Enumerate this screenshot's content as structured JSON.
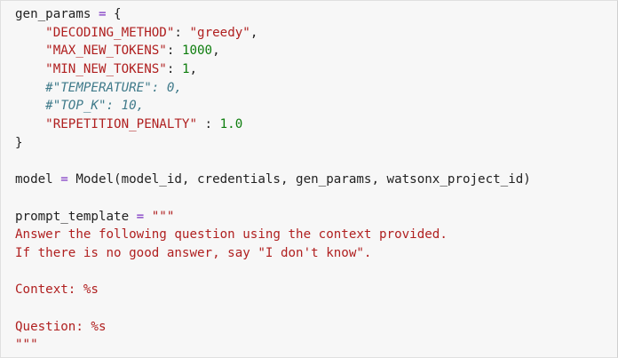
{
  "cell": {
    "lines": [
      {
        "id": "gp-open",
        "tokens": [
          {
            "t": "txt",
            "v": "gen_params "
          },
          {
            "t": "op",
            "v": "="
          },
          {
            "t": "txt",
            "v": " {"
          }
        ]
      },
      {
        "id": "gp-decode",
        "tokens": [
          {
            "t": "txt",
            "v": "    "
          },
          {
            "t": "str",
            "v": "\"DECODING_METHOD\""
          },
          {
            "t": "txt",
            "v": ": "
          },
          {
            "t": "str",
            "v": "\"greedy\""
          },
          {
            "t": "txt",
            "v": ","
          }
        ]
      },
      {
        "id": "gp-max",
        "tokens": [
          {
            "t": "txt",
            "v": "    "
          },
          {
            "t": "str",
            "v": "\"MAX_NEW_TOKENS\""
          },
          {
            "t": "txt",
            "v": ": "
          },
          {
            "t": "num",
            "v": "1000"
          },
          {
            "t": "txt",
            "v": ","
          }
        ]
      },
      {
        "id": "gp-min",
        "tokens": [
          {
            "t": "txt",
            "v": "    "
          },
          {
            "t": "str",
            "v": "\"MIN_NEW_TOKENS\""
          },
          {
            "t": "txt",
            "v": ": "
          },
          {
            "t": "num",
            "v": "1"
          },
          {
            "t": "txt",
            "v": ","
          }
        ]
      },
      {
        "id": "gp-temp",
        "tokens": [
          {
            "t": "txt",
            "v": "    "
          },
          {
            "t": "cmt",
            "v": "#\"TEMPERATURE\": 0,"
          }
        ]
      },
      {
        "id": "gp-topk",
        "tokens": [
          {
            "t": "txt",
            "v": "    "
          },
          {
            "t": "cmt",
            "v": "#\"TOP_K\": 10,"
          }
        ]
      },
      {
        "id": "gp-rep",
        "tokens": [
          {
            "t": "txt",
            "v": "    "
          },
          {
            "t": "str",
            "v": "\"REPETITION_PENALTY\""
          },
          {
            "t": "txt",
            "v": " : "
          },
          {
            "t": "num",
            "v": "1.0"
          }
        ]
      },
      {
        "id": "gp-close",
        "tokens": [
          {
            "t": "txt",
            "v": "}"
          }
        ]
      },
      {
        "id": "blank-1",
        "tokens": [
          {
            "t": "txt",
            "v": ""
          }
        ]
      },
      {
        "id": "model",
        "tokens": [
          {
            "t": "txt",
            "v": "model "
          },
          {
            "t": "op",
            "v": "="
          },
          {
            "t": "txt",
            "v": " Model(model_id, credentials, gen_params, watsonx_project_id)"
          }
        ]
      },
      {
        "id": "blank-2",
        "tokens": [
          {
            "t": "txt",
            "v": ""
          }
        ]
      },
      {
        "id": "pt-open",
        "tokens": [
          {
            "t": "txt",
            "v": "prompt_template "
          },
          {
            "t": "op",
            "v": "="
          },
          {
            "t": "txt",
            "v": " "
          },
          {
            "t": "doc",
            "v": "\"\"\""
          }
        ]
      },
      {
        "id": "pt-l1",
        "tokens": [
          {
            "t": "doc",
            "v": "Answer the following question using the context provided."
          }
        ]
      },
      {
        "id": "pt-l2",
        "tokens": [
          {
            "t": "doc",
            "v": "If there is no good answer, say \"I don't know\"."
          }
        ]
      },
      {
        "id": "blank-3",
        "tokens": [
          {
            "t": "txt",
            "v": ""
          }
        ]
      },
      {
        "id": "pt-context",
        "tokens": [
          {
            "t": "doc",
            "v": "Context: %s"
          }
        ]
      },
      {
        "id": "blank-4",
        "tokens": [
          {
            "t": "txt",
            "v": ""
          }
        ]
      },
      {
        "id": "pt-question",
        "tokens": [
          {
            "t": "doc",
            "v": "Question: %s"
          }
        ]
      },
      {
        "id": "pt-close",
        "tokens": [
          {
            "t": "doc",
            "v": "\"\"\""
          }
        ]
      }
    ]
  },
  "colors": {
    "background": "#f7f7f7",
    "text": "#222222",
    "string": "#b02020",
    "number": "#0d7d0d",
    "operator": "#7a2fc0",
    "comment": "#3f7a8a"
  }
}
